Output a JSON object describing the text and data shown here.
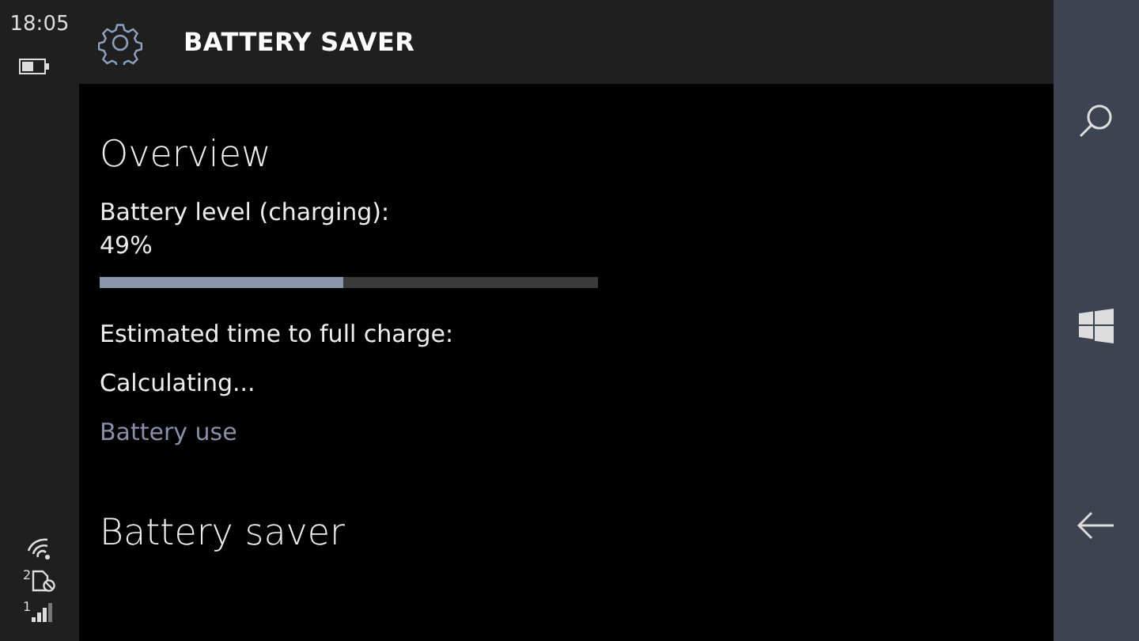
{
  "status_bar": {
    "time": "18:05",
    "sim_2_label": "2",
    "sim_1_label": "1"
  },
  "header": {
    "title": "BATTERY SAVER"
  },
  "overview": {
    "heading": "Overview",
    "battery_label": "Battery level (charging):",
    "battery_percent": "49%",
    "level": 0.49,
    "estimate_label": "Estimated time to full charge:",
    "estimate_value": "Calculating...",
    "link": "Battery use"
  },
  "battery_saver": {
    "heading": "Battery saver"
  }
}
